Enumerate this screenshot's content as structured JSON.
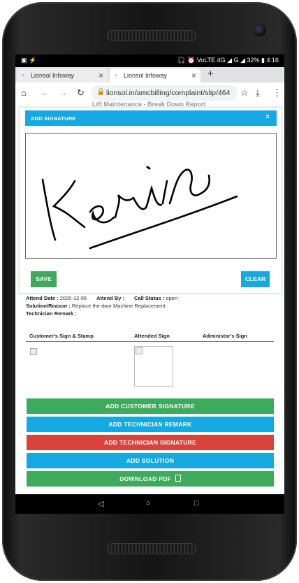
{
  "status_bar": {
    "left_icons": "▣ ⚡",
    "right": "🎧 ⏰ VoLTE 4G ◢ G ◢ 32% ▮ 4:16"
  },
  "browser": {
    "tabs": [
      {
        "label": "Lionsol Infoway",
        "close": "×"
      },
      {
        "label": "Lionsol Infoway",
        "close": "×"
      }
    ],
    "new_tab": "+",
    "url": "lionsol.in/amcbilling/complaint/slip/464"
  },
  "page": {
    "heading": "Lift Maintenance - Break Down Report"
  },
  "modal": {
    "title": "ADD SIGNATURE",
    "close": "×",
    "save_label": "SAVE",
    "clear_label": "CLEAR"
  },
  "details": {
    "attend_date_label": "Attend Date :",
    "attend_date_value": " 2020-12-05",
    "attend_by_label": "Attend By :",
    "call_status_label": "Call Status :",
    "call_status_value": " open",
    "solution_label": "Solution/Reason :",
    "solution_value": " Replace the door Machine Replacement",
    "remark_label": "Technician Remark :"
  },
  "signatures": {
    "customer": "Customer's Sign & Stamp",
    "attended": "Attended Sign",
    "administor": "Administor's Sign"
  },
  "actions": [
    {
      "label": "ADD CUSTOMER SIGNATURE",
      "color": "#3eaa5b"
    },
    {
      "label": "ADD TECHNICIAN REMARK",
      "color": "#16a9e1"
    },
    {
      "label": "ADD TECHNICIAN SIGNATURE",
      "color": "#d9443a"
    },
    {
      "label": "ADD SOLUTION",
      "color": "#16a9e1"
    },
    {
      "label": "DOWNLOAD PDF",
      "color": "#3eaa5b"
    }
  ],
  "nav": {
    "back": "◁",
    "home": "○",
    "recents": "□"
  }
}
